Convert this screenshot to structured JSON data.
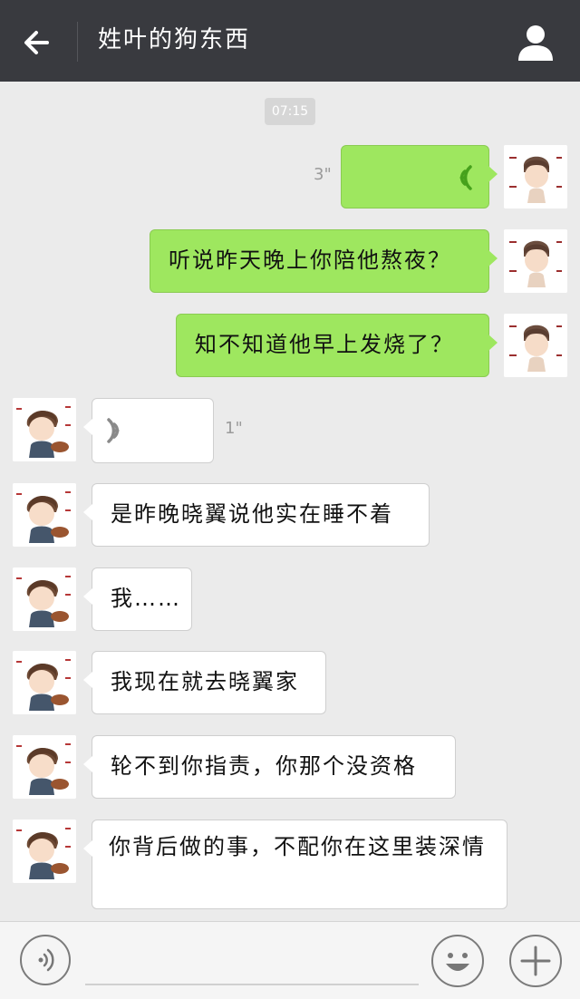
{
  "header": {
    "title": "姓叶的狗东西"
  },
  "chat": {
    "timestamp": "07:15",
    "messages": [
      {
        "side": "sent",
        "type": "voice",
        "duration": "3\""
      },
      {
        "side": "sent",
        "type": "text",
        "text": "听说昨天晚上你陪他熬夜？"
      },
      {
        "side": "sent",
        "type": "text",
        "text": "知不知道他早上发烧了？"
      },
      {
        "side": "received",
        "type": "voice",
        "duration": "1\""
      },
      {
        "side": "received",
        "type": "text",
        "text": "是昨晚晓翼说他实在睡不着"
      },
      {
        "side": "received",
        "type": "text",
        "text": "我……"
      },
      {
        "side": "received",
        "type": "text",
        "text": "我现在就去晓翼家"
      },
      {
        "side": "received",
        "type": "text",
        "text": "轮不到你指责，你那个没资格"
      },
      {
        "side": "received",
        "type": "text",
        "text": "你背后做的事，不配你在这里装深情"
      }
    ]
  },
  "inputbar": {
    "message_value": ""
  },
  "colors": {
    "header_bg": "#393a3f",
    "sent_bubble": "#9ee75f",
    "received_bubble": "#ffffff",
    "voice_wave_sent": "#46a11c"
  },
  "icons": [
    "back-arrow-icon",
    "user-profile-icon",
    "voice-wave-icon",
    "emoji-icon",
    "plus-icon",
    "voice-input-icon"
  ]
}
